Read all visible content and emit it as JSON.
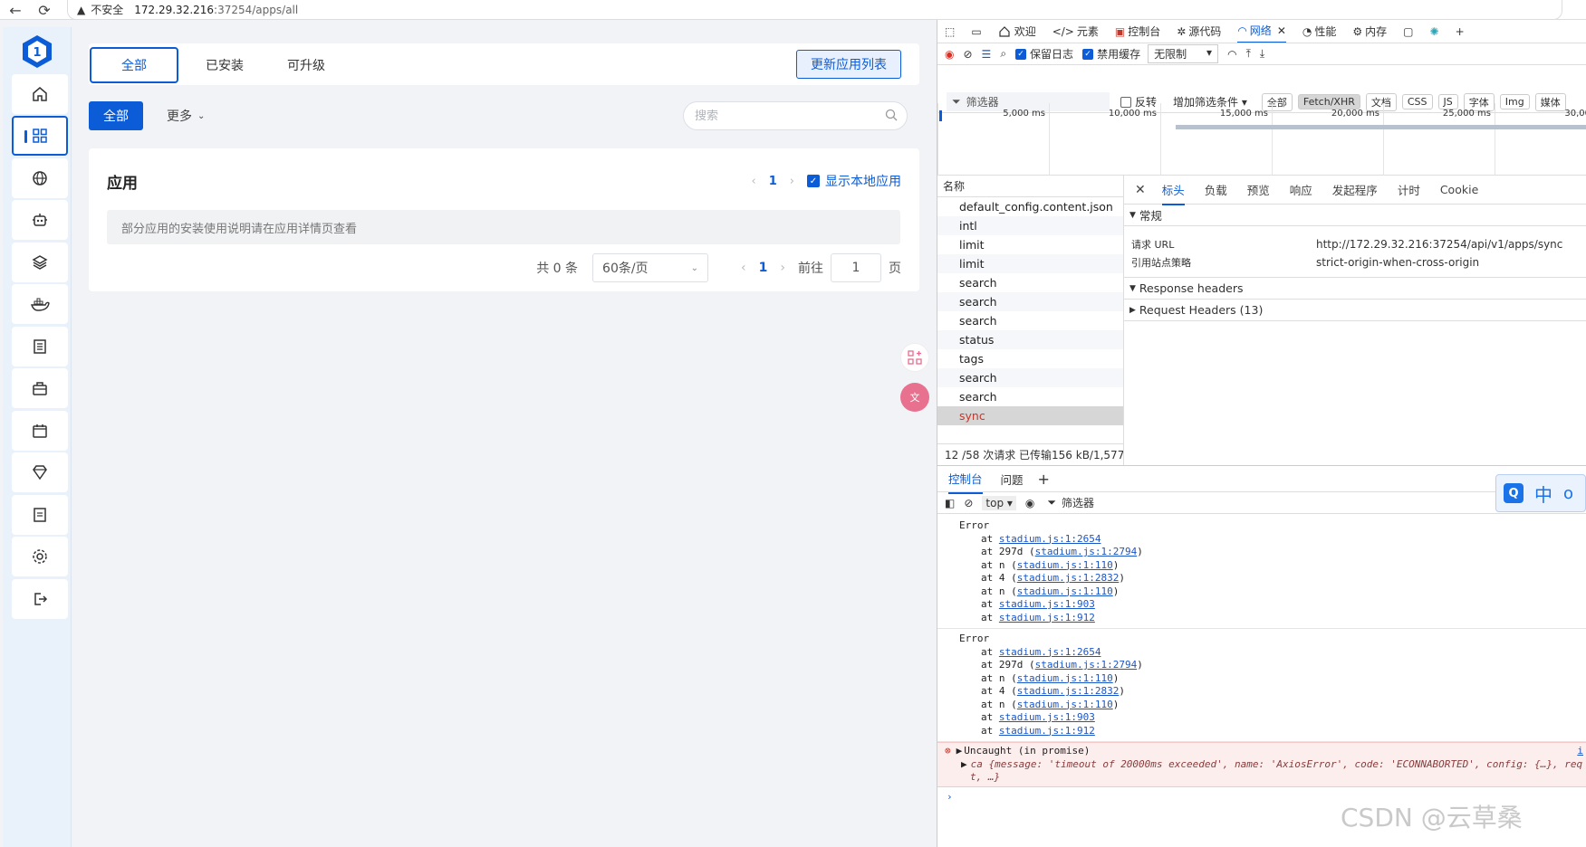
{
  "browser": {
    "security_label": "不安全",
    "url_host": "172.29.32.216",
    "url_path": ":37254/apps/all"
  },
  "app": {
    "tabs": [
      "全部",
      "已安装",
      "可升级"
    ],
    "update_button": "更新应用列表",
    "filter_all": "全部",
    "filter_more": "更多",
    "search_placeholder": "搜索",
    "card": {
      "title": "应用",
      "page": "1",
      "show_local": "显示本地应用",
      "hint": "部分应用的安装使用说明请在应用详情页查看",
      "total": "共 0 条",
      "page_size": "60条/页",
      "goto_label": "前往",
      "goto_value": "1",
      "page_unit": "页"
    }
  },
  "devtools": {
    "tabs": [
      "欢迎",
      "元素",
      "控制台",
      "源代码",
      "网络",
      "性能",
      "内存"
    ],
    "toolbar": {
      "preserve_log": "保留日志",
      "disable_cache": "禁用缓存",
      "throttle": "无限制"
    },
    "filterbar": {
      "filter_placeholder": "筛选器",
      "invert": "反转",
      "more_filters": "增加筛选条件",
      "types": [
        "全部",
        "Fetch/XHR",
        "文档",
        "CSS",
        "JS",
        "字体",
        "Img",
        "媒体"
      ]
    },
    "timeline_ticks": [
      "5,000 ms",
      "10,000 ms",
      "15,000 ms",
      "20,000 ms",
      "25,000 ms",
      "30,00"
    ],
    "list_header": "名称",
    "requests": [
      "default_config.content.json",
      "intl",
      "limit",
      "limit",
      "search",
      "search",
      "search",
      "status",
      "tags",
      "search",
      "search",
      "sync"
    ],
    "detail_tabs": [
      "标头",
      "负载",
      "预览",
      "响应",
      "发起程序",
      "计时",
      "Cookie"
    ],
    "general_label": "常规",
    "request_url_key": "请求 URL",
    "request_url_value": "http://172.29.32.216:37254/api/v1/apps/sync",
    "referrer_key": "引用站点策略",
    "referrer_value": "strict-origin-when-cross-origin",
    "response_headers": "Response headers",
    "request_headers": "Request Headers (13)",
    "status": "12 /58 次请求  已传输156 kB/1,577",
    "drawer_tabs": [
      "控制台",
      "问题"
    ],
    "console_context": "top",
    "console_filter": "筛选器",
    "error1_title": "Error",
    "error2_title": "Error",
    "stack": [
      {
        "pre": "at ",
        "link": "stadium.js:1:2654",
        "post": ""
      },
      {
        "pre": "at 297d (",
        "link": "stadium.js:1:2794",
        "post": ")"
      },
      {
        "pre": "at n (",
        "link": "stadium.js:1:110",
        "post": ")"
      },
      {
        "pre": "at 4 (",
        "link": "stadium.js:1:2832",
        "post": ")"
      },
      {
        "pre": "at n (",
        "link": "stadium.js:1:110",
        "post": ")"
      },
      {
        "pre": "at ",
        "link": "stadium.js:1:903",
        "post": ""
      },
      {
        "pre": "at ",
        "link": "stadium.js:1:912",
        "post": ""
      }
    ],
    "uncaught": "Uncaught (in promise)",
    "uncaught_detail": "ca {message: 'timeout of 20000ms exceeded', name: 'AxiosError', code: 'ECONNABORTED', config: {…}, req",
    "uncaught_detail2": "t, …}",
    "uncaught_link": "i"
  },
  "ime": {
    "lang": "中",
    "dot": "o"
  },
  "watermark": "CSDN @云草桑",
  "colors": {
    "primary": "#0b5cd6",
    "sidebar_bg": "#e9f1fb",
    "error_bg": "#fdeeee"
  }
}
